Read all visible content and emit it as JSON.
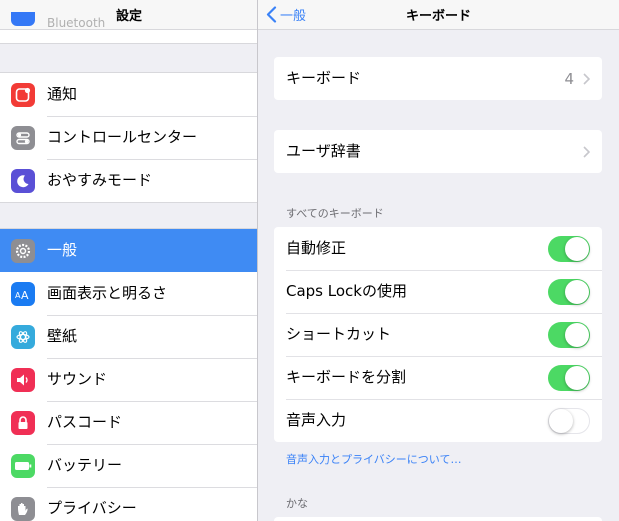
{
  "left": {
    "title": "設定",
    "peek_item": "Bluetooth",
    "group_a": [
      {
        "label": "通知",
        "icon": "notifications-icon",
        "color": "#f23b36"
      },
      {
        "label": "コントロールセンター",
        "icon": "control-center-icon",
        "color": "#8e8e93"
      },
      {
        "label": "おやすみモード",
        "icon": "moon-icon",
        "color": "#5a50d6"
      }
    ],
    "group_b": [
      {
        "label": "一般",
        "icon": "gear-icon",
        "color": "#8e8e93",
        "selected": true
      },
      {
        "label": "画面表示と明るさ",
        "icon": "display-brightness-icon",
        "color": "#1a7bf2"
      },
      {
        "label": "壁紙",
        "icon": "wallpaper-icon",
        "color": "#35aadc"
      },
      {
        "label": "サウンド",
        "icon": "speaker-icon",
        "color": "#f02f55"
      },
      {
        "label": "パスコード",
        "icon": "lock-icon",
        "color": "#f02f55"
      },
      {
        "label": "バッテリー",
        "icon": "battery-icon",
        "color": "#4cd964"
      },
      {
        "label": "プライバシー",
        "icon": "hand-icon",
        "color": "#8e8e93"
      }
    ]
  },
  "nav": {
    "back_label": "一般",
    "title": "キーボード"
  },
  "keyboards_row": {
    "label": "キーボード",
    "value": "4"
  },
  "dictionary_row": {
    "label": "ユーザ辞書"
  },
  "all_keyboards_header": "すべてのキーボード",
  "toggles": [
    {
      "label": "自動修正",
      "on": true
    },
    {
      "label": "Caps Lockの使用",
      "on": true
    },
    {
      "label": "ショートカット",
      "on": true
    },
    {
      "label": "キーボードを分割",
      "on": true
    },
    {
      "label": "音声入力",
      "on": false
    }
  ],
  "privacy_link": "音声入力とプライバシーについて…",
  "kana_header": "かな",
  "colors": {
    "accent": "#3a82f7",
    "switch_on": "#4cd964",
    "selected_row": "#3f8bf3"
  }
}
